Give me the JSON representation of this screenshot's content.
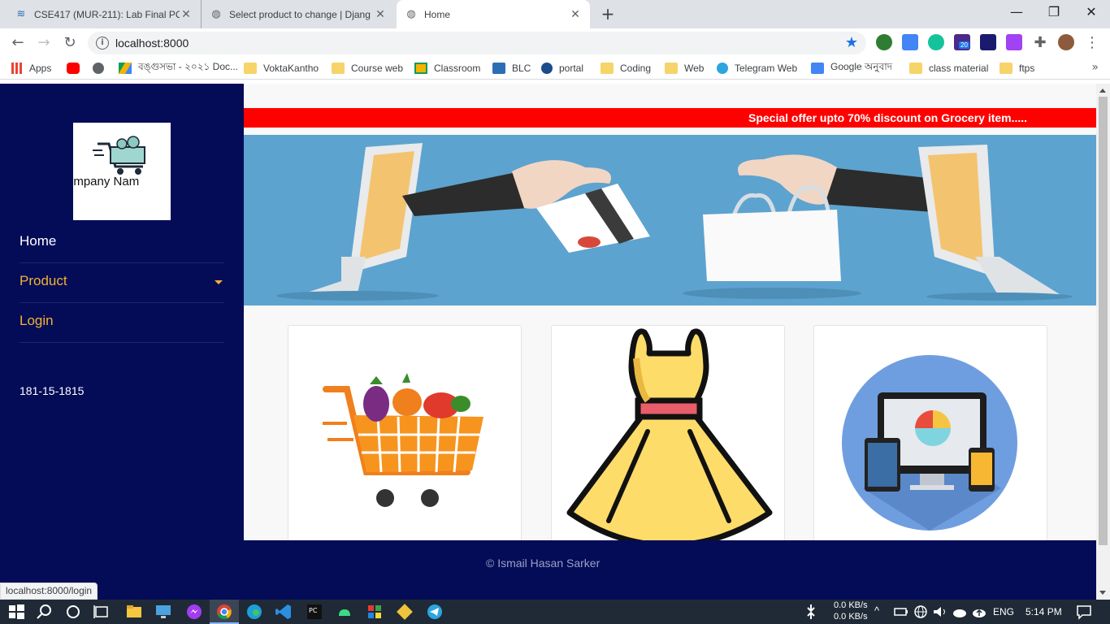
{
  "browser": {
    "tabs": [
      {
        "title": "CSE417 (MUR-211): Lab Final PC-",
        "close": "✕"
      },
      {
        "title": "Select product to change | Djang",
        "close": "✕"
      },
      {
        "title": "Home",
        "close": "✕"
      }
    ],
    "new_tab": "+",
    "window_controls": {
      "minimize": "—",
      "restore": "❐",
      "close": "✕"
    },
    "url": "localhost:8000",
    "bookmarks": [
      "Apps",
      "বঙ্গুসভা - ২০২১ Doc...",
      "VoktaKantho",
      "Course web",
      "Classroom",
      "BLC",
      "portal",
      "Coding",
      "Web",
      "Telegram Web",
      "Google অনুবাদ",
      "class material",
      "ftps"
    ],
    "bookmarks_more": "»",
    "status_url": "localhost:8000/login",
    "extension_badge": "20"
  },
  "sidebar": {
    "logo_text": "ompany Nam",
    "nav": [
      {
        "label": "Home",
        "color": "#ffffff"
      },
      {
        "label": "Product",
        "color": "#f2b233"
      },
      {
        "label": "Login",
        "color": "#f2b233"
      }
    ],
    "student_id": "181-15-1815"
  },
  "main": {
    "marquee": "Special offer upto 70% discount on Grocery item.....",
    "cards": [
      {
        "category": "grocery-cart-icon"
      },
      {
        "category": "dress-icon"
      },
      {
        "category": "electronics-devices-icon"
      }
    ]
  },
  "footer": {
    "text": "© Ismail Hasan Sarker"
  },
  "taskbar": {
    "net_down": "0.0 KB/s",
    "net_up": "0.0 KB/s",
    "lang": "ENG",
    "time": "5:14 PM"
  },
  "colors": {
    "sidebar_bg": "#040c57",
    "accent": "#f2b233",
    "marquee_bg": "#ff0000",
    "banner_bg": "#5da3cf"
  }
}
